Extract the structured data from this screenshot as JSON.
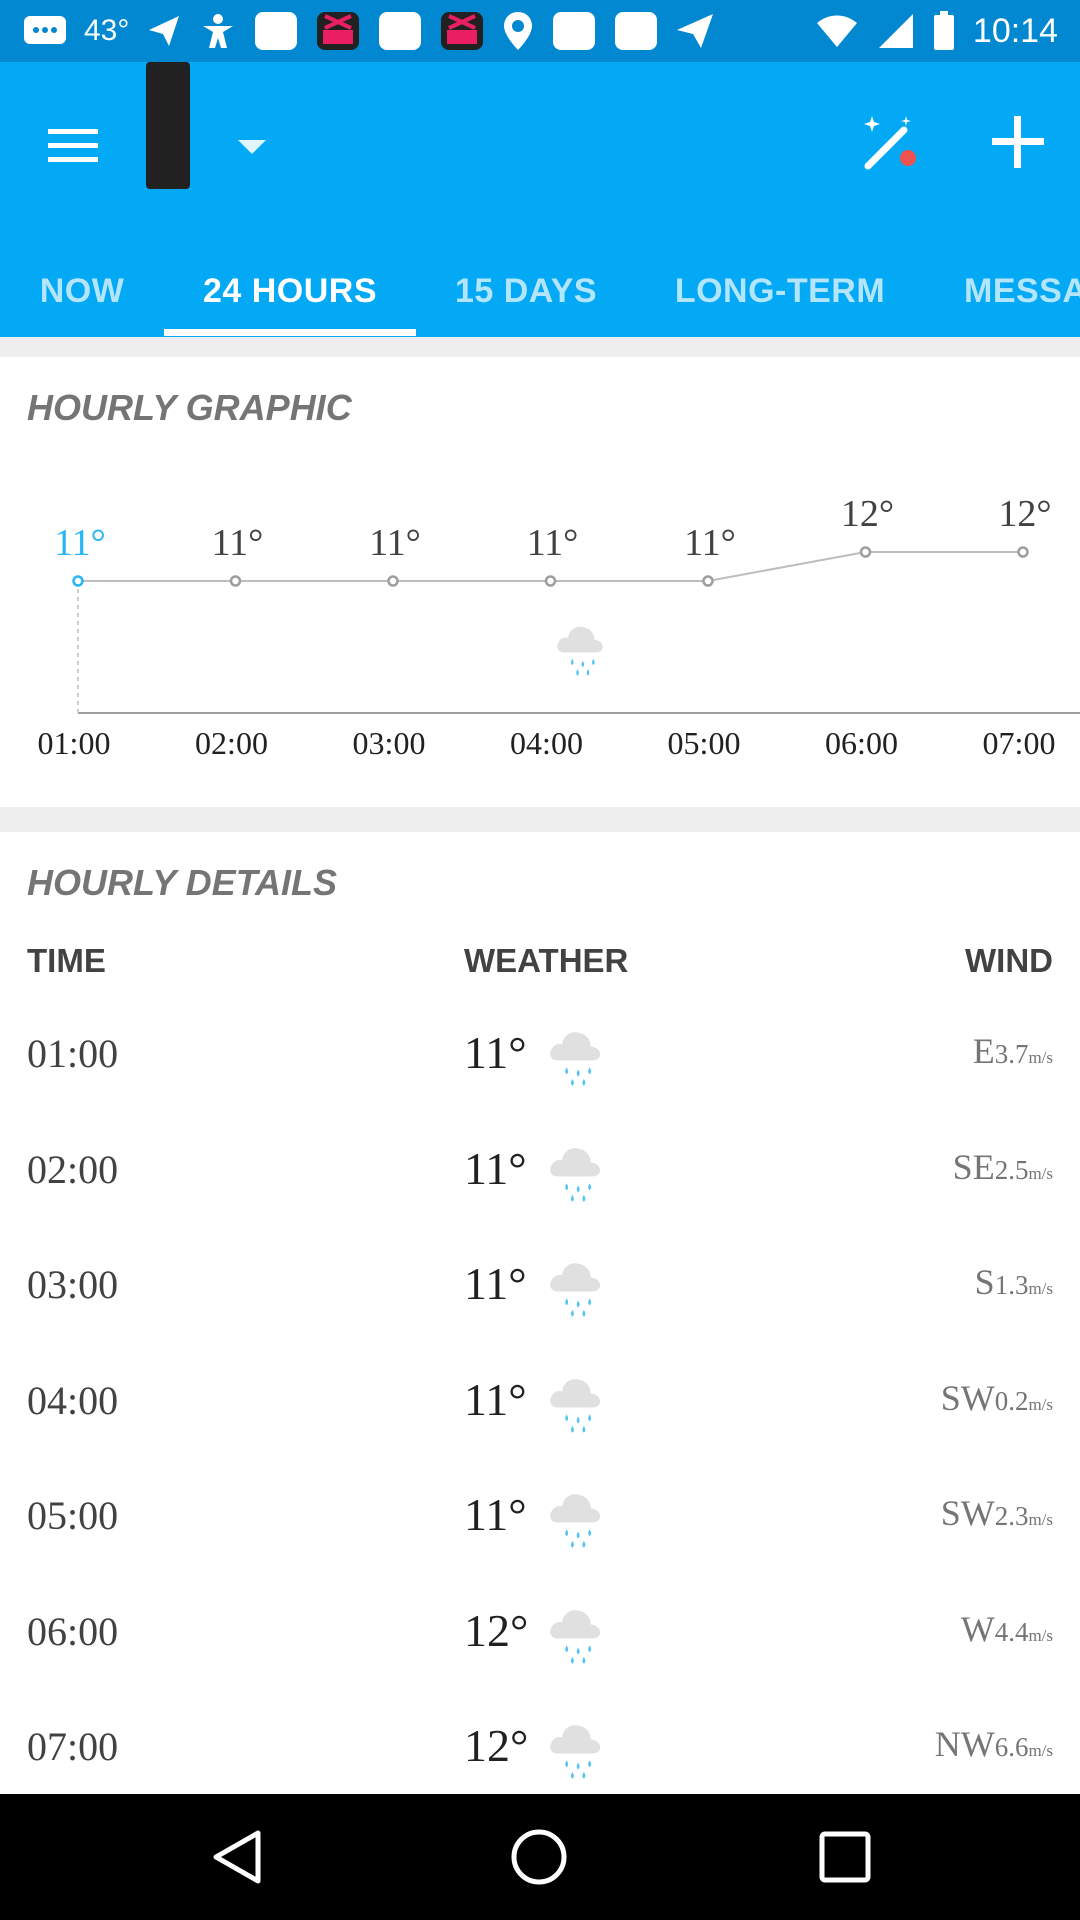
{
  "status_bar": {
    "temperature": "43°",
    "time": "10:14",
    "notification_icons": [
      "chat-icon",
      "send-icon",
      "accessibility-icon",
      "app-icon",
      "popcorn-icon",
      "app-icon",
      "popcorn-icon",
      "location-pin-icon",
      "app-icon",
      "app-icon",
      "send-icon",
      "wifi-icon",
      "cell-signal-icon",
      "battery-icon"
    ]
  },
  "app_bar": {
    "menu_icon": "menu-icon",
    "dropdown_icon": "caret-down-icon",
    "wand_icon": "magic-wand-icon",
    "add_icon": "plus-icon"
  },
  "tabs": [
    {
      "label": "NOW",
      "active": false
    },
    {
      "label": "24 HOURS",
      "active": true
    },
    {
      "label": "15 DAYS",
      "active": false
    },
    {
      "label": "LONG-TERM",
      "active": false
    },
    {
      "label": "MESSA",
      "active": false
    }
  ],
  "hourly_graphic": {
    "title": "HOURLY GRAPHIC",
    "chart_data": {
      "type": "line",
      "x": [
        "01:00",
        "02:00",
        "03:00",
        "04:00",
        "05:00",
        "06:00",
        "07:00"
      ],
      "series": [
        {
          "values": [
            11,
            11,
            11,
            11,
            11,
            12,
            12
          ]
        }
      ],
      "point_labels": [
        "11°",
        "11°",
        "11°",
        "11°",
        "11°",
        "12°",
        "12°"
      ],
      "precipitation_icon_at": "04:00"
    }
  },
  "hourly_details": {
    "title": "HOURLY DETAILS",
    "columns": {
      "time": "TIME",
      "weather": "WEATHER",
      "wind": "WIND"
    },
    "rows": [
      {
        "time": "01:00",
        "temp": "11°",
        "icon": "rain-cloud-icon",
        "wind_dir": "E",
        "wind_speed": "3.7",
        "wind_unit": "m/s"
      },
      {
        "time": "02:00",
        "temp": "11°",
        "icon": "rain-cloud-icon",
        "wind_dir": "SE",
        "wind_speed": "2.5",
        "wind_unit": "m/s"
      },
      {
        "time": "03:00",
        "temp": "11°",
        "icon": "rain-cloud-icon",
        "wind_dir": "S",
        "wind_speed": "1.3",
        "wind_unit": "m/s"
      },
      {
        "time": "04:00",
        "temp": "11°",
        "icon": "rain-cloud-icon",
        "wind_dir": "SW",
        "wind_speed": "0.2",
        "wind_unit": "m/s"
      },
      {
        "time": "05:00",
        "temp": "11°",
        "icon": "rain-cloud-icon",
        "wind_dir": "SW",
        "wind_speed": "2.3",
        "wind_unit": "m/s"
      },
      {
        "time": "06:00",
        "temp": "12°",
        "icon": "rain-cloud-icon",
        "wind_dir": "W",
        "wind_speed": "4.4",
        "wind_unit": "m/s"
      },
      {
        "time": "07:00",
        "temp": "12°",
        "icon": "rain-cloud-icon",
        "wind_dir": "NW",
        "wind_speed": "6.6",
        "wind_unit": "m/s"
      }
    ]
  },
  "nav_bar": {
    "back_icon": "back-triangle-icon",
    "home_icon": "home-circle-icon",
    "recents_icon": "recents-square-icon"
  },
  "colors": {
    "status_bar": "#0288d1",
    "app_bar": "#03a9f4",
    "accent_point": "#29b6f6",
    "rain_drop": "#4fc3f7"
  }
}
